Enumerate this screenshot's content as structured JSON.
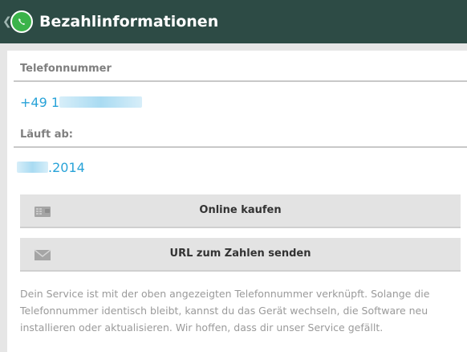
{
  "actionbar": {
    "title": "Bezahlinformationen",
    "back_icon": "chevron-left-icon",
    "app_icon": "whatsapp-icon",
    "bar_color": "#2d4b45"
  },
  "phone_section": {
    "header": "Telefonnummer",
    "value_prefix": "+49 1"
  },
  "expiry_section": {
    "header": "Läuft ab:",
    "value_suffix": ".2014"
  },
  "buttons": [
    {
      "label": "Online kaufen",
      "icon": "wallet-icon"
    },
    {
      "label": "URL zum Zahlen senden",
      "icon": "envelope-icon"
    }
  ],
  "info_text": "Dein Service ist mit der oben angezeigten Telefonnummer verknüpft. Solange die Telefonnummer identisch bleibt, kannst du das Gerät wechseln, die Software neu installieren oder aktualisieren. Wir hoffen, dass dir unser Service gefällt.",
  "colors": {
    "accent": "#29a3d8",
    "header_text": "#7f7f7f",
    "button_bg": "#e3e3e3"
  }
}
